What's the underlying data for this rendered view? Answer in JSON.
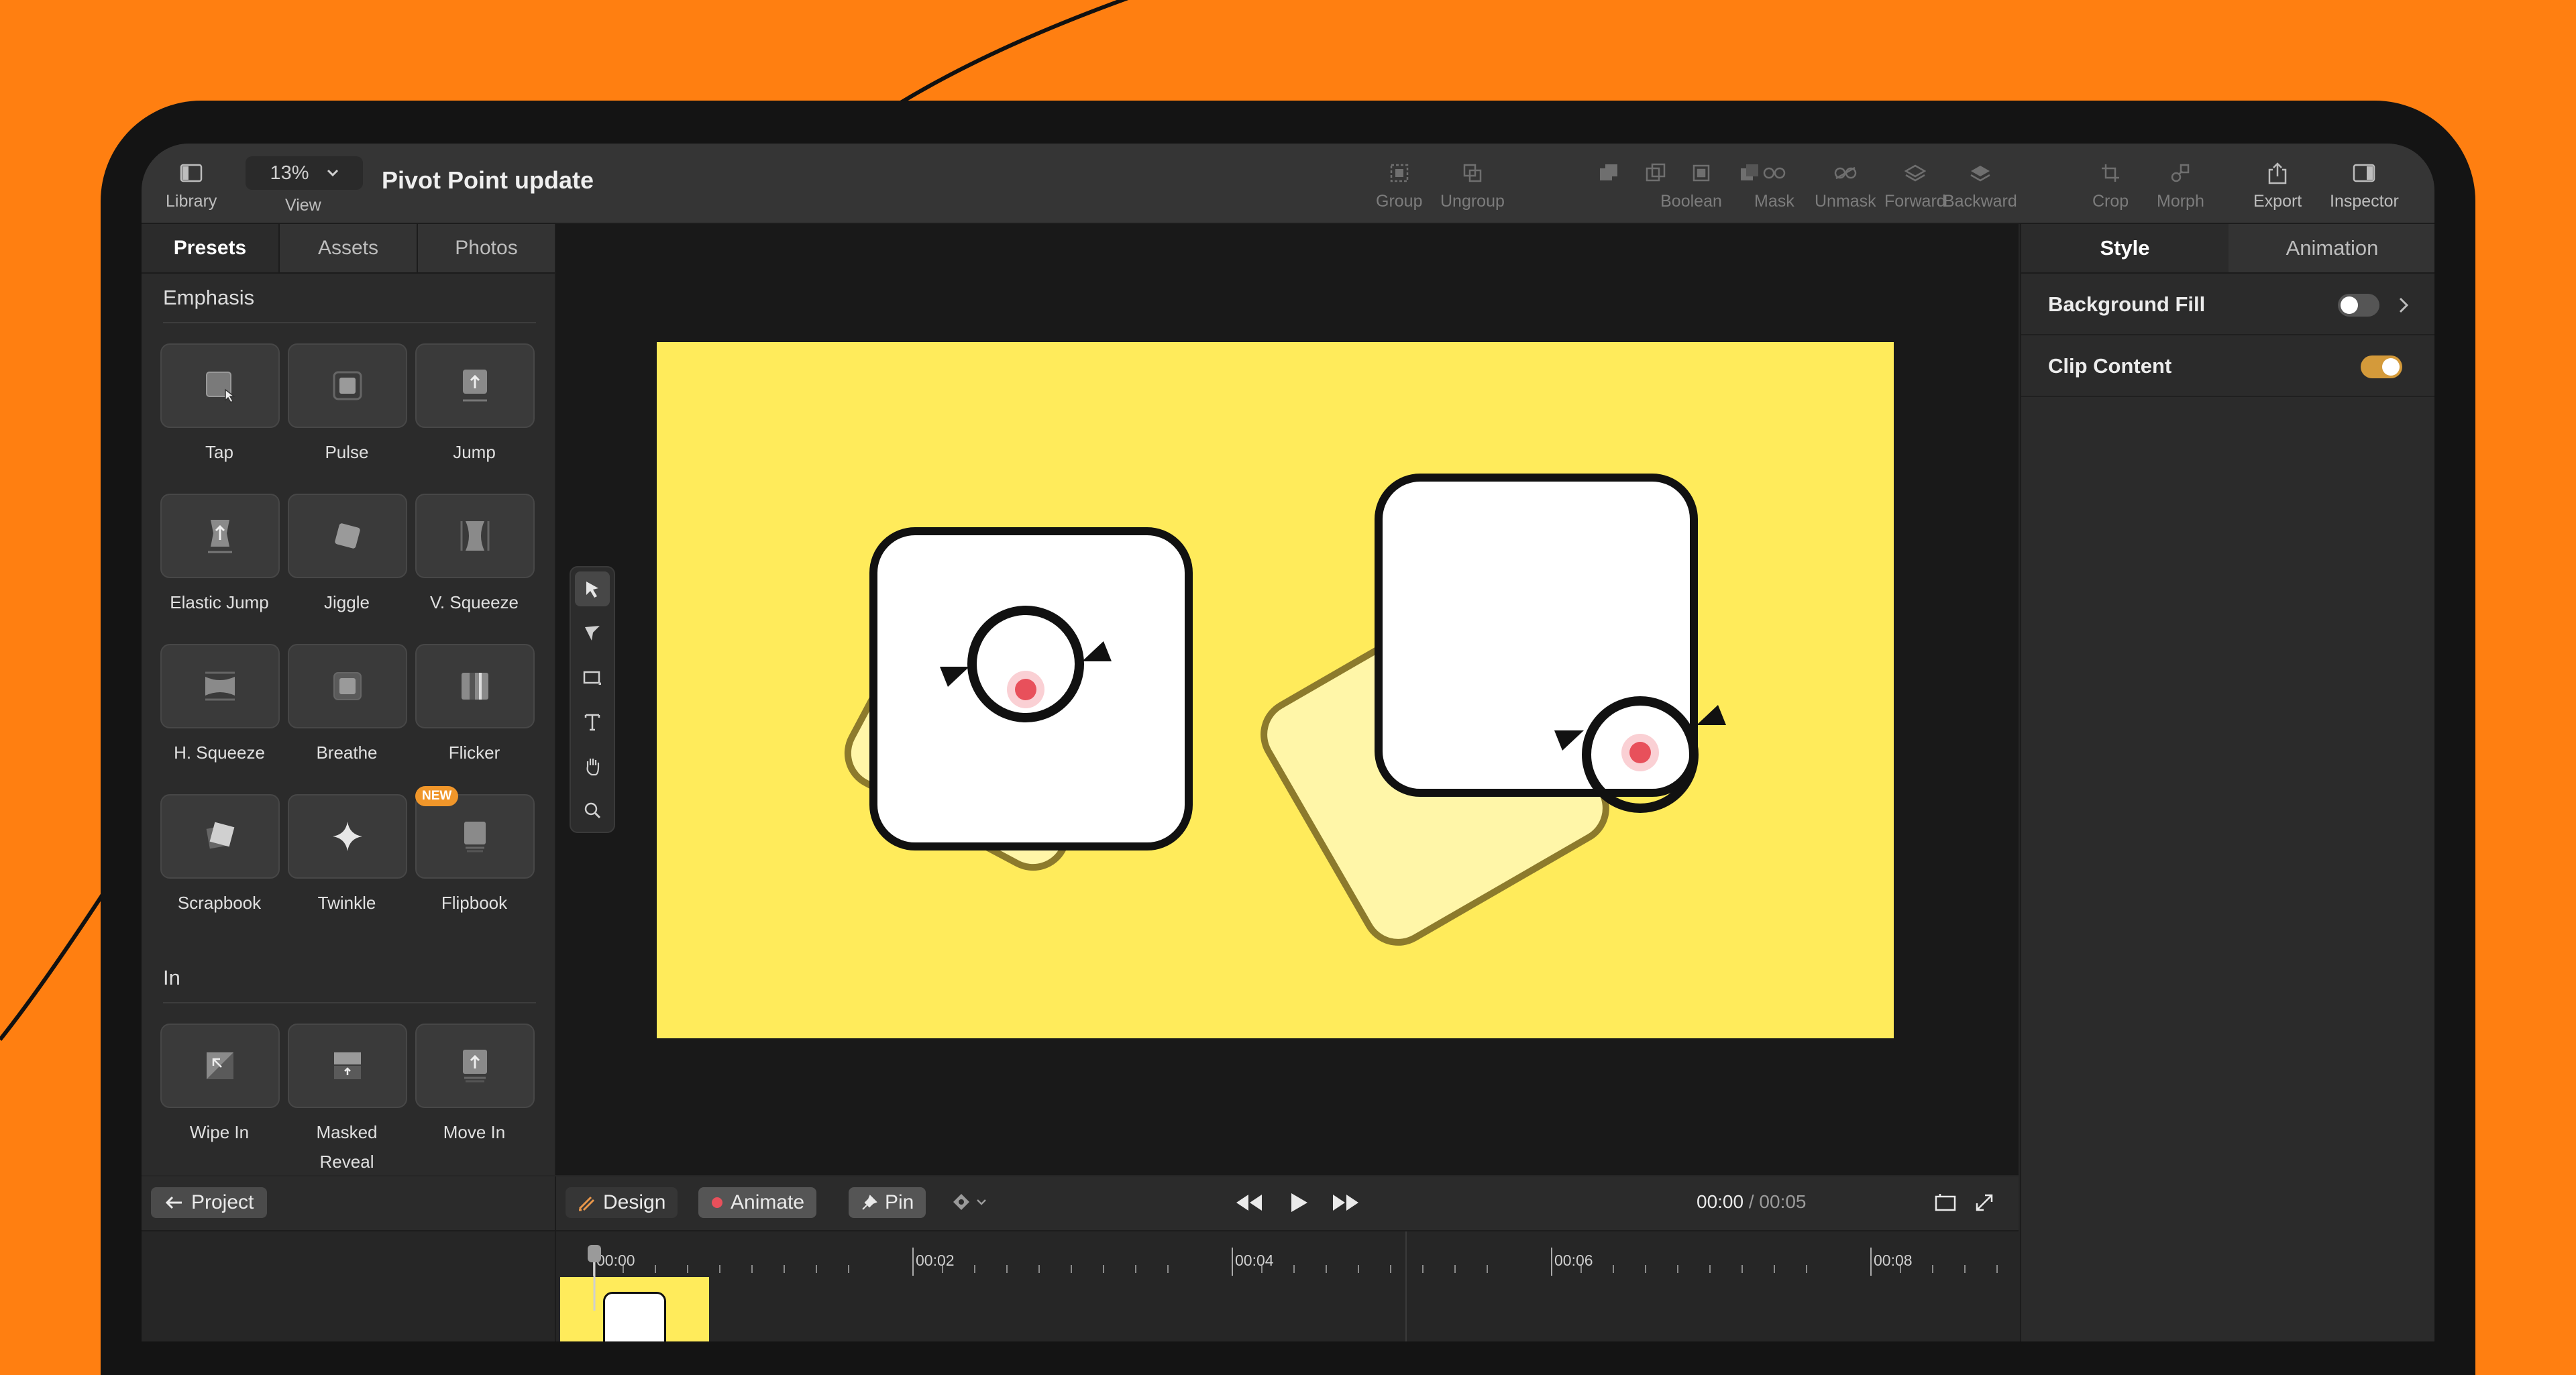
{
  "toolbar": {
    "library": "Library",
    "zoom": "13%",
    "view": "View",
    "title": "Pivot Point update",
    "group": "Group",
    "ungroup": "Ungroup",
    "boolean": "Boolean",
    "mask": "Mask",
    "unmask": "Unmask",
    "forward": "Forward",
    "backward": "Backward",
    "crop": "Crop",
    "morph": "Morph",
    "export": "Export",
    "inspector": "Inspector"
  },
  "left_panel": {
    "tabs": [
      "Presets",
      "Assets",
      "Photos"
    ],
    "emphasis_title": "Emphasis",
    "emphasis": [
      "Tap",
      "Pulse",
      "Jump",
      "Elastic Jump",
      "Jiggle",
      "V. Squeeze",
      "H. Squeeze",
      "Breathe",
      "Flicker",
      "Scrapbook",
      "Twinkle",
      "Flipbook"
    ],
    "new_badge": "NEW",
    "in_title": "In",
    "in_items": [
      "Wipe In",
      "Masked Reveal",
      "Move In"
    ]
  },
  "right_panel": {
    "tabs": [
      "Style",
      "Animation"
    ],
    "background_fill": "Background Fill",
    "clip_content": "Clip Content",
    "background_fill_on": false,
    "clip_content_on": true,
    "toggle_on_color": "#D49A3A"
  },
  "bottom": {
    "project": "Project",
    "design": "Design",
    "animate": "Animate",
    "pin": "Pin",
    "time_current": "00:00",
    "time_separator": " / ",
    "time_total": "00:05",
    "ticks": [
      "00:00",
      "00:02",
      "00:04",
      "00:06",
      "00:08"
    ]
  },
  "colors": {
    "background": "#FF7F11",
    "artboard": "#FFEB5B",
    "pivot": "#E8505B"
  }
}
